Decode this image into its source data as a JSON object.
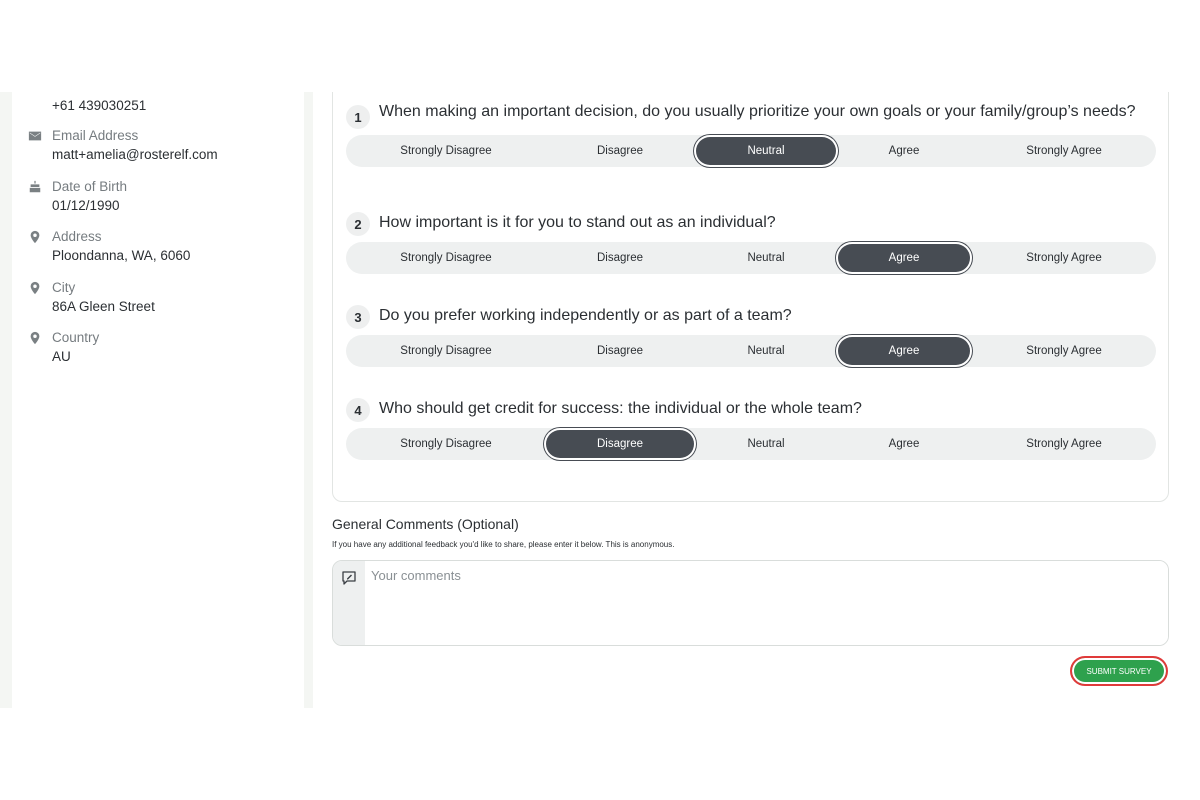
{
  "profile": {
    "phone": "+61 439030251",
    "fields": [
      {
        "label": "Email Address",
        "value": "matt+amelia@rosterelf.com",
        "icon": "envelope-icon"
      },
      {
        "label": "Date of Birth",
        "value": "01/12/1990",
        "icon": "cake-icon"
      },
      {
        "label": "Address",
        "value": "Ploondanna, WA, 6060",
        "icon": "location-pin-icon"
      },
      {
        "label": "City",
        "value": "86A Gleen Street",
        "icon": "location-pin-icon"
      },
      {
        "label": "Country",
        "value": "AU",
        "icon": "location-pin-icon"
      }
    ]
  },
  "scale_options": [
    "Strongly Disagree",
    "Disagree",
    "Neutral",
    "Agree",
    "Strongly Agree"
  ],
  "questions": [
    {
      "number": "1",
      "text": "When making an important decision, do you usually prioritize your own goals or your family/group’s needs?",
      "selected": "Neutral"
    },
    {
      "number": "2",
      "text": "How important is it for you to stand out as an individual?",
      "selected": "Agree"
    },
    {
      "number": "3",
      "text": "Do you prefer working independently or as part of a team?",
      "selected": "Agree"
    },
    {
      "number": "4",
      "text": "Who should get credit for success: the individual or the whole team?",
      "selected": "Disagree"
    }
  ],
  "comments": {
    "title": "General Comments (Optional)",
    "subtitle": "If you have any additional feedback you'd like to share, please enter it below. This is anonymous.",
    "placeholder": "Your comments",
    "icon": "comment-edit-icon"
  },
  "submit_label": "SUBMIT SURVEY",
  "colors": {
    "selected_option": "#474c53",
    "submit_green": "#2ea14d",
    "submit_highlight": "#e03a3a"
  }
}
